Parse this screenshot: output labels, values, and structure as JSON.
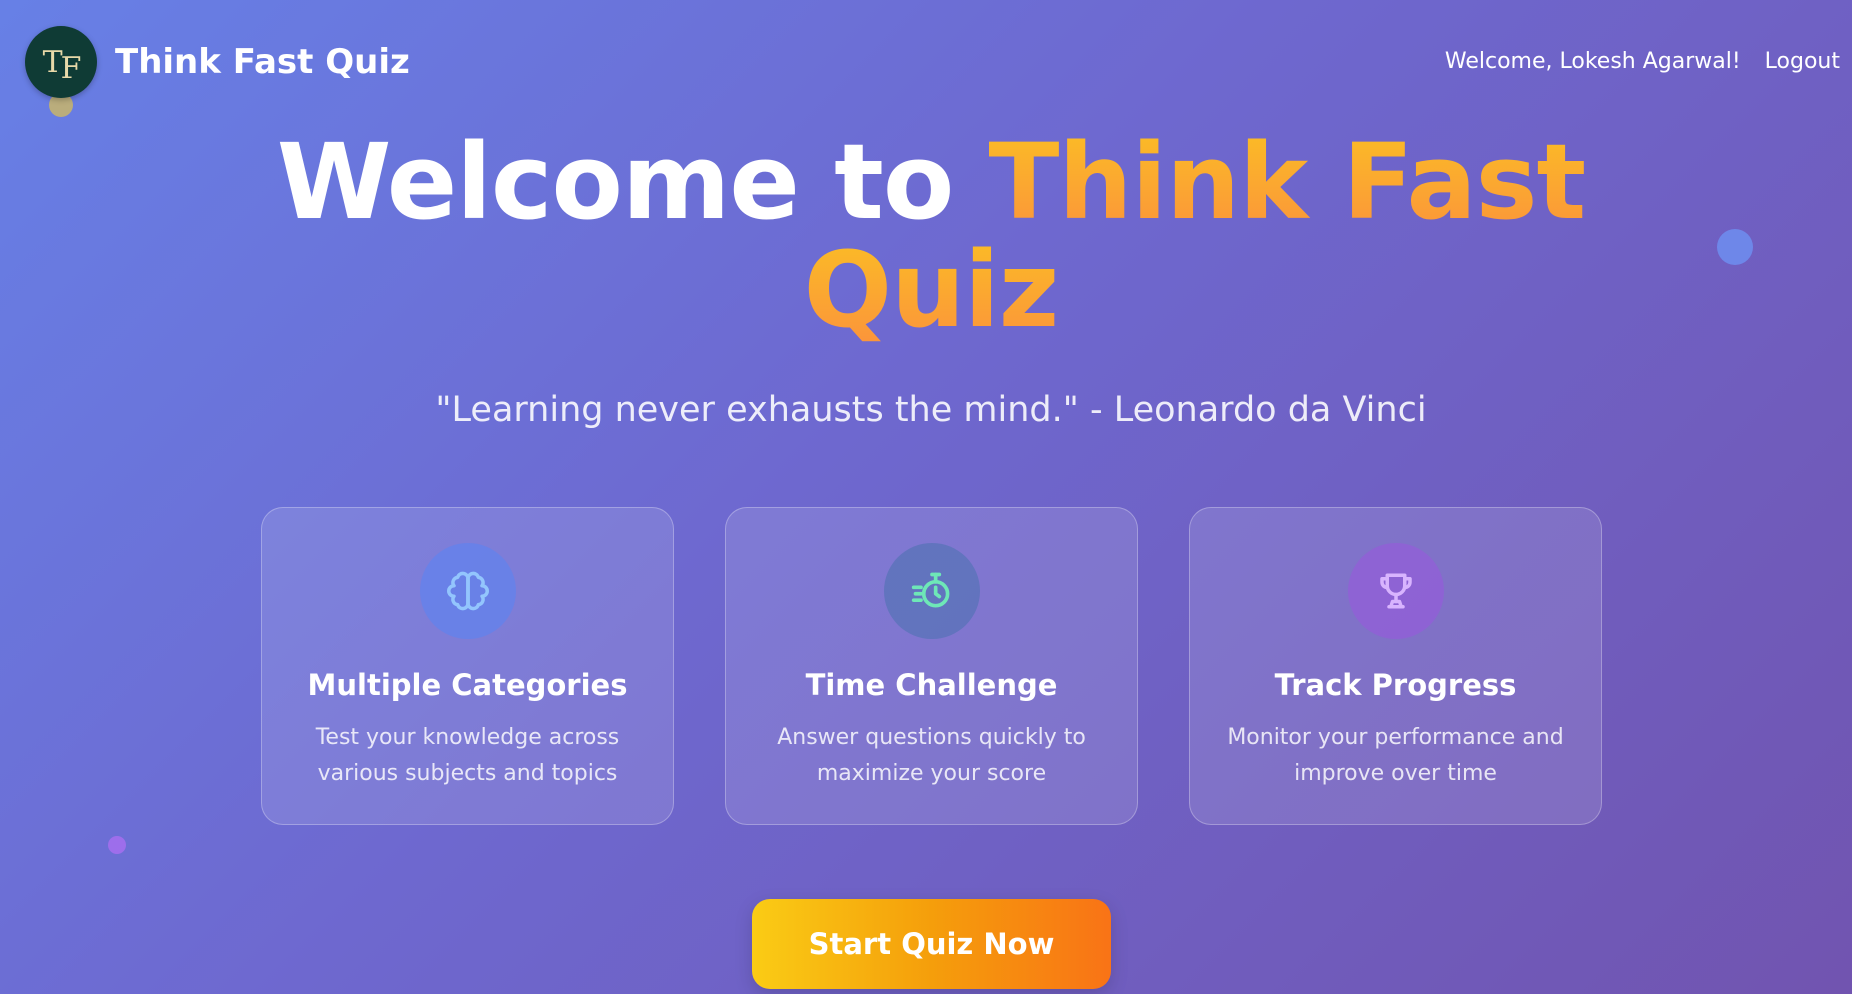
{
  "header": {
    "logo_text_t": "T",
    "logo_text_f": "F",
    "brand": "Think Fast Quiz",
    "welcome": "Welcome, Lokesh Agarwal!",
    "logout": "Logout"
  },
  "hero": {
    "title_plain": "Welcome to ",
    "title_accent_1": "Think Fast",
    "title_accent_2": "Quiz",
    "quote": "\"Learning never exhausts the mind.\" - Leonardo da Vinci"
  },
  "features": [
    {
      "icon": "brain-icon",
      "title": "Multiple Categories",
      "description": "Test your knowledge across various subjects and topics",
      "icon_color": "#93c5fd"
    },
    {
      "icon": "stopwatch-icon",
      "title": "Time Challenge",
      "description": "Answer questions quickly to maximize your score",
      "icon_color": "#6ee7b7"
    },
    {
      "icon": "trophy-icon",
      "title": "Track Progress",
      "description": "Monitor your performance and improve over time",
      "icon_color": "#d8b4fe"
    }
  ],
  "cta": {
    "label": "Start Quiz Now"
  },
  "colors": {
    "accent_start": "#fbbf24",
    "accent_end": "#f97316",
    "logo_bg": "#0f3b35"
  }
}
